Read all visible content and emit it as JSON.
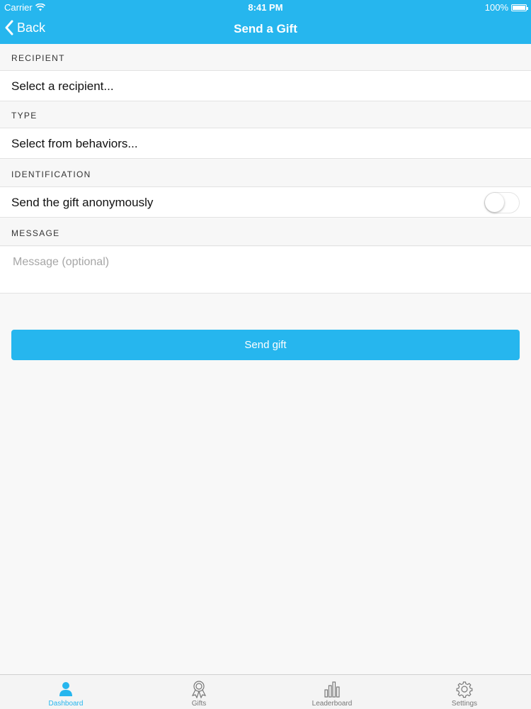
{
  "status_bar": {
    "carrier": "Carrier",
    "time": "8:41 PM",
    "battery": "100%"
  },
  "nav": {
    "back_label": "Back",
    "title": "Send a Gift"
  },
  "sections": {
    "recipient": {
      "header": "RECIPIENT",
      "value": "Select a recipient..."
    },
    "type": {
      "header": "TYPE",
      "value": "Select from behaviors..."
    },
    "identification": {
      "header": "IDENTIFICATION",
      "label": "Send the gift anonymously",
      "toggle_on": false
    },
    "message": {
      "header": "MESSAGE",
      "placeholder": "Message (optional)"
    }
  },
  "send_button": {
    "label": "Send gift"
  },
  "tabbar": {
    "items": [
      {
        "label": "Dashboard",
        "icon": "person-icon",
        "active": true
      },
      {
        "label": "Gifts",
        "icon": "ribbon-award-icon",
        "active": false
      },
      {
        "label": "Leaderboard",
        "icon": "bar-chart-icon",
        "active": false
      },
      {
        "label": "Settings",
        "icon": "gear-icon",
        "active": false
      }
    ]
  },
  "colors": {
    "accent": "#26b6ee",
    "background": "#f8f8f8",
    "separator": "#e2e2e2"
  }
}
